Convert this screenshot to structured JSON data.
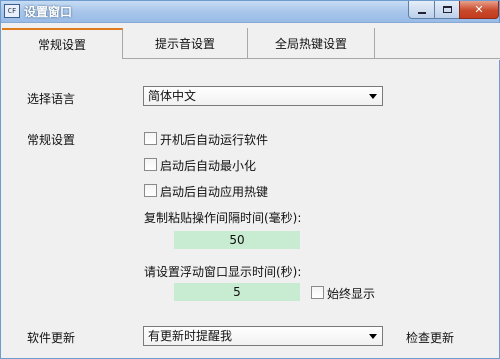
{
  "window": {
    "title": "设置窗口",
    "icon": "CF"
  },
  "tabs": [
    {
      "label": "常规设置",
      "active": true
    },
    {
      "label": "提示音设置",
      "active": false
    },
    {
      "label": "全局热键设置",
      "active": false
    }
  ],
  "language": {
    "label": "选择语言",
    "selected": "简体中文"
  },
  "general": {
    "label": "常规设置",
    "autostart": {
      "label": "开机后自动运行软件",
      "checked": false
    },
    "minimize": {
      "label": "启动后自动最小化",
      "checked": false
    },
    "hotkeys": {
      "label": "启动后自动应用热键",
      "checked": false
    }
  },
  "copy_paste": {
    "label": "复制粘贴操作间隔时间(毫秒):",
    "value": "50"
  },
  "float_window": {
    "label": "请设置浮动窗口显示时间(秒):",
    "value": "5",
    "always_show": {
      "label": "始终显示",
      "checked": false
    }
  },
  "update": {
    "label": "软件更新",
    "selected": "有更新时提醒我",
    "check_button": "检查更新"
  },
  "colors": {
    "active_tab_accent": "#e07a1f",
    "input_bg": "#c8ecd2"
  }
}
